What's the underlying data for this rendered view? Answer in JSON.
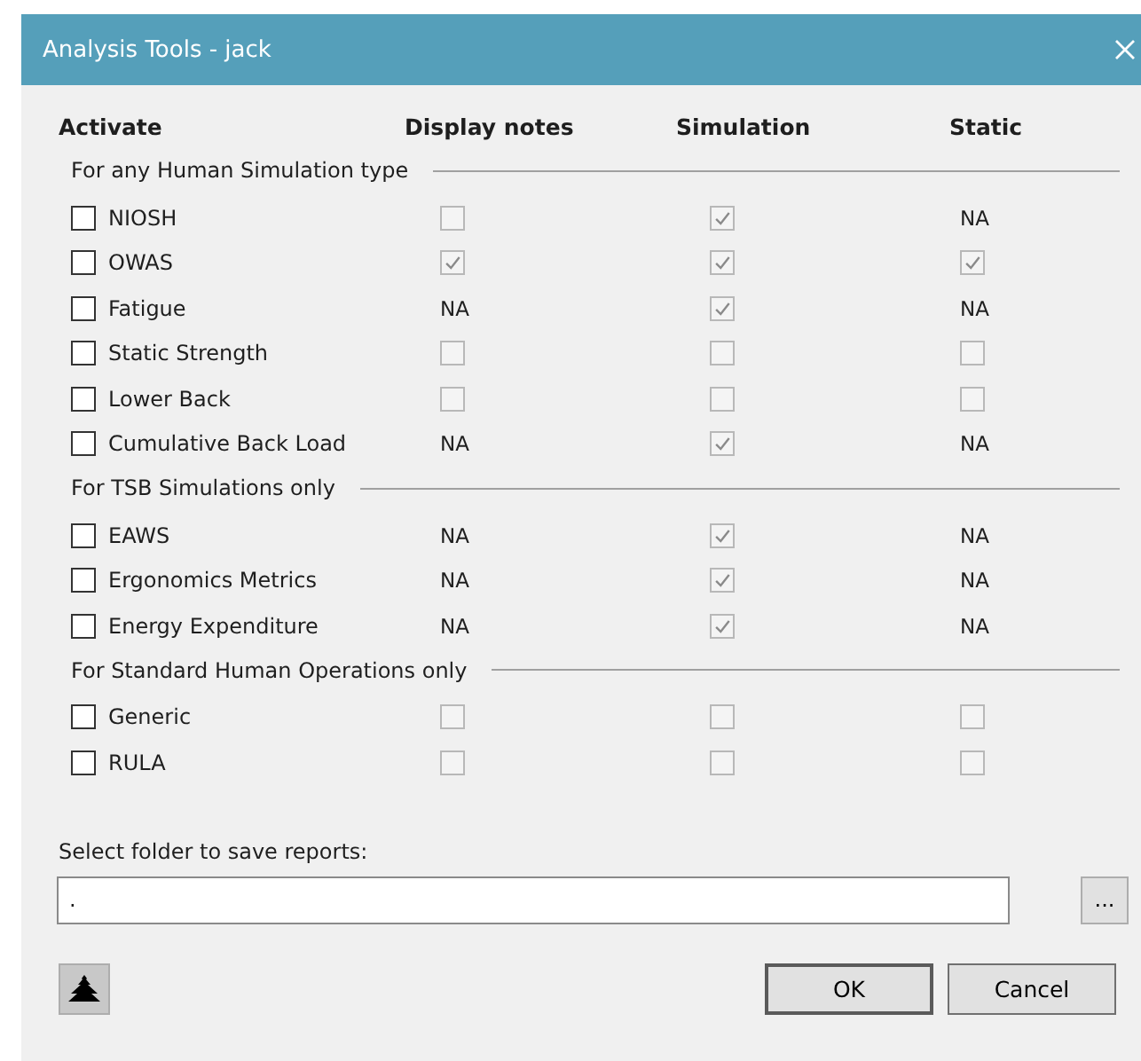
{
  "window": {
    "title": "Analysis Tools - jack"
  },
  "columns": [
    "Activate",
    "Display notes",
    "Simulation",
    "Static"
  ],
  "sections": [
    {
      "title": "For any Human Simulation type",
      "rows": [
        {
          "label": "NIOSH",
          "activate": false,
          "cells": [
            {
              "kind": "check",
              "checked": false
            },
            {
              "kind": "check",
              "checked": true
            },
            {
              "kind": "na",
              "text": "NA"
            }
          ]
        },
        {
          "label": "OWAS",
          "activate": false,
          "cells": [
            {
              "kind": "check",
              "checked": true
            },
            {
              "kind": "check",
              "checked": true
            },
            {
              "kind": "check",
              "checked": true
            }
          ]
        },
        {
          "label": "Fatigue",
          "activate": false,
          "cells": [
            {
              "kind": "na",
              "text": "NA"
            },
            {
              "kind": "check",
              "checked": true
            },
            {
              "kind": "na",
              "text": "NA"
            }
          ]
        },
        {
          "label": "Static Strength",
          "activate": false,
          "cells": [
            {
              "kind": "check",
              "checked": false
            },
            {
              "kind": "check",
              "checked": false
            },
            {
              "kind": "check",
              "checked": false
            }
          ]
        },
        {
          "label": "Lower Back",
          "activate": false,
          "cells": [
            {
              "kind": "check",
              "checked": false
            },
            {
              "kind": "check",
              "checked": false
            },
            {
              "kind": "check",
              "checked": false
            }
          ]
        },
        {
          "label": "Cumulative Back Load",
          "activate": false,
          "cells": [
            {
              "kind": "na",
              "text": "NA"
            },
            {
              "kind": "check",
              "checked": true
            },
            {
              "kind": "na",
              "text": "NA"
            }
          ]
        }
      ]
    },
    {
      "title": "For TSB Simulations only",
      "rows": [
        {
          "label": "EAWS",
          "activate": false,
          "cells": [
            {
              "kind": "na",
              "text": "NA"
            },
            {
              "kind": "check",
              "checked": true
            },
            {
              "kind": "na",
              "text": "NA"
            }
          ]
        },
        {
          "label": "Ergonomics Metrics",
          "activate": false,
          "cells": [
            {
              "kind": "na",
              "text": "NA"
            },
            {
              "kind": "check",
              "checked": true
            },
            {
              "kind": "na",
              "text": "NA"
            }
          ]
        },
        {
          "label": "Energy Expenditure",
          "activate": false,
          "cells": [
            {
              "kind": "na",
              "text": "NA"
            },
            {
              "kind": "check",
              "checked": true
            },
            {
              "kind": "na",
              "text": "NA"
            }
          ]
        }
      ]
    },
    {
      "title": "For Standard Human Operations only",
      "rows": [
        {
          "label": "Generic",
          "activate": false,
          "cells": [
            {
              "kind": "check",
              "checked": false
            },
            {
              "kind": "check",
              "checked": false
            },
            {
              "kind": "check",
              "checked": false
            }
          ]
        },
        {
          "label": "RULA",
          "activate": false,
          "cells": [
            {
              "kind": "check",
              "checked": false
            },
            {
              "kind": "check",
              "checked": false
            },
            {
              "kind": "check",
              "checked": false
            }
          ]
        }
      ]
    }
  ],
  "folder": {
    "label": "Select folder to save reports:",
    "value": ".",
    "browse": "..."
  },
  "buttons": [
    "OK",
    "Cancel"
  ]
}
